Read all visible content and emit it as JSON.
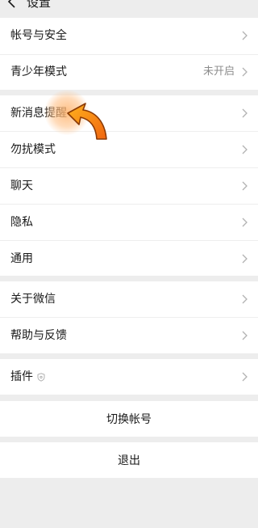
{
  "header": {
    "title": "设置"
  },
  "settings": {
    "account_security": "帐号与安全",
    "youth_mode": "青少年模式",
    "youth_mode_status": "未开启",
    "message_notification": "新消息提醒",
    "do_not_disturb": "勿扰模式",
    "chat": "聊天",
    "privacy": "隐私",
    "general": "通用",
    "about_wechat": "关于微信",
    "help_feedback": "帮助与反馈",
    "plugins": "插件",
    "switch_account": "切换帐号",
    "logout": "退出"
  },
  "colors": {
    "background": "#ededed",
    "row_background": "#ffffff",
    "text": "#191919",
    "secondary_text": "#8c8c8c",
    "arrow_accent": "#f28a1a"
  },
  "icons": {
    "back": "chevron-left-icon",
    "row_arrow": "chevron-right-icon",
    "plugin": "shield-icon",
    "tutorial_pointer": "curved-arrow-icon"
  }
}
